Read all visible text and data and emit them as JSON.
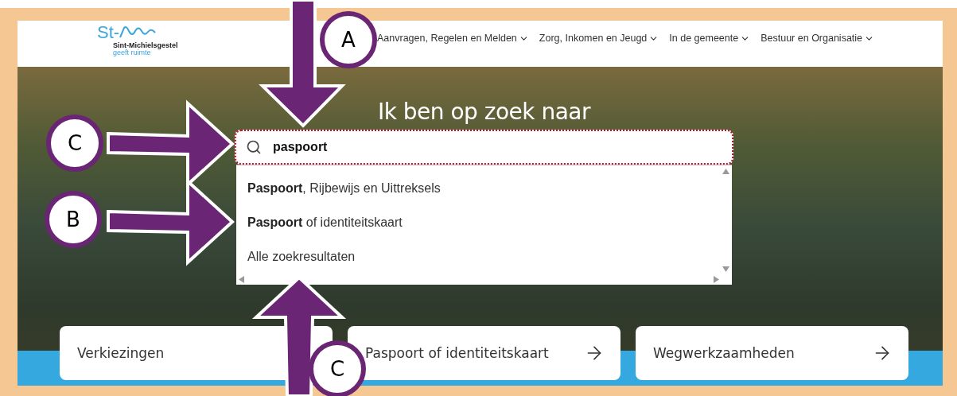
{
  "header": {
    "logo": {
      "mark": "St-",
      "name": "Sint-Michielsgestel",
      "tagline": "geeft ruimte"
    },
    "nav": [
      {
        "label": "Aanvragen, Regelen en Melden"
      },
      {
        "label": "Zorg, Inkomen en Jeugd"
      },
      {
        "label": "In de gemeente"
      },
      {
        "label": "Bestuur en Organisatie"
      }
    ]
  },
  "hero": {
    "title": "Ik ben op zoek naar",
    "search": {
      "value": "paspoort"
    },
    "suggestions": [
      {
        "label": "**Paspoort**, Rijbewijs en Uittreksels"
      },
      {
        "label": "**Paspoort** of identiteitskaart"
      },
      {
        "label": "Alle zoekresultaten"
      }
    ],
    "cards": [
      {
        "label": "Verkiezingen"
      },
      {
        "label": "Paspoort of identiteitskaart"
      },
      {
        "label": "Wegwerkzaamheden"
      }
    ]
  },
  "annotations": [
    {
      "label": "A",
      "kind": "down"
    },
    {
      "label": "C",
      "kind": "right"
    },
    {
      "label": "B",
      "kind": "right"
    },
    {
      "label": "C",
      "kind": "up"
    }
  ]
}
